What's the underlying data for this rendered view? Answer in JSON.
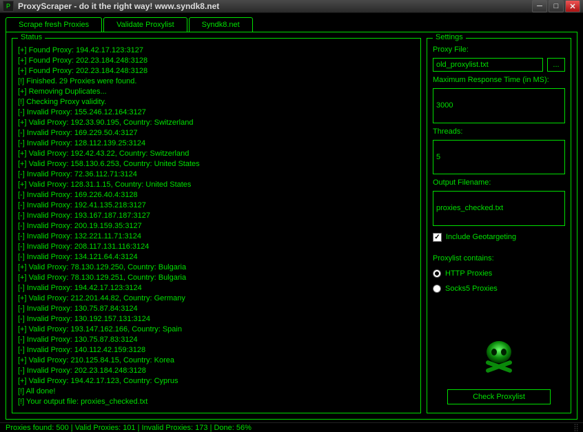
{
  "title": "ProxyScraper - do it the right way! www.syndk8.net",
  "tabs": [
    {
      "label": "Scrape fresh Proxies"
    },
    {
      "label": "Validate Proxylist"
    },
    {
      "label": "Syndk8.net"
    }
  ],
  "active_tab": 1,
  "status_box": {
    "title": "Status",
    "lines": [
      "[+] Found Proxy: 194.42.17.123:3127",
      "[+] Found Proxy: 202.23.184.248:3128",
      "[+] Found Proxy: 202.23.184.248:3128",
      "[!] Finished. 29 Proxies were found.",
      "[+] Removing Duplicates...",
      "[!] Checking Proxy validity.",
      "[-] Invalid Proxy: 155.246.12.164:3127",
      "[+] Valid Proxy: 192.33.90.195, Country: Switzerland",
      "[-] Invalid Proxy: 169.229.50.4:3127",
      "[-] Invalid Proxy: 128.112.139.25:3124",
      "[+] Valid Proxy: 192.42.43.22, Country: Switzerland",
      "[+] Valid Proxy: 158.130.6.253, Country: United States",
      "[-] Invalid Proxy: 72.36.112.71:3124",
      "[+] Valid Proxy: 128.31.1.15, Country: United States",
      "[-] Invalid Proxy: 169.226.40.4:3128",
      "[-] Invalid Proxy: 192.41.135.218:3127",
      "[-] Invalid Proxy: 193.167.187.187:3127",
      "[-] Invalid Proxy: 200.19.159.35:3127",
      "[-] Invalid Proxy: 132.221.11.71:3124",
      "[-] Invalid Proxy: 208.117.131.116:3124",
      "[-] Invalid Proxy: 134.121.64.4:3124",
      "[+] Valid Proxy: 78.130.129.250, Country: Bulgaria",
      "[+] Valid Proxy: 78.130.129.251, Country: Bulgaria",
      "[-] Invalid Proxy: 194.42.17.123:3124",
      "[+] Valid Proxy: 212.201.44.82, Country: Germany",
      "[-] Invalid Proxy: 130.75.87.84:3124",
      "[-] Invalid Proxy: 130.192.157.131:3124",
      "[+] Valid Proxy: 193.147.162.166, Country: Spain",
      "[-] Invalid Proxy: 130.75.87.83:3124",
      "[-] Invalid Proxy: 140.112.42.159:3128",
      "[+] Valid Proxy: 210.125.84.15, Country: Korea",
      "[-] Invalid Proxy: 202.23.184.248:3128",
      "[+] Valid Proxy: 194.42.17.123, Country: Cyprus",
      "[!] All done!",
      "[!] Your output file: proxies_checked.txt"
    ]
  },
  "settings": {
    "title": "Settings",
    "proxy_file_label": "Proxy File:",
    "proxy_file_value": "old_proxylist.txt",
    "browse_label": "...",
    "max_response_label": "Maximum Response Time (in MS):",
    "max_response_value": "3000",
    "threads_label": "Threads:",
    "threads_value": "5",
    "output_label": "Output Filename:",
    "output_value": "proxies_checked.txt",
    "geotargeting_label": "Include Geotargeting",
    "geotargeting_checked": true,
    "proxylist_contains_label": "Proxylist contains:",
    "radio_http_label": "HTTP Proxies",
    "radio_socks_label": "Socks5 Proxies",
    "radio_selected": "http",
    "check_button": "Check Proxylist"
  },
  "statusbar": "Proxies found: 500  |  Valid Proxies: 101  |  Invalid Proxies: 173  |  Done: 56%"
}
